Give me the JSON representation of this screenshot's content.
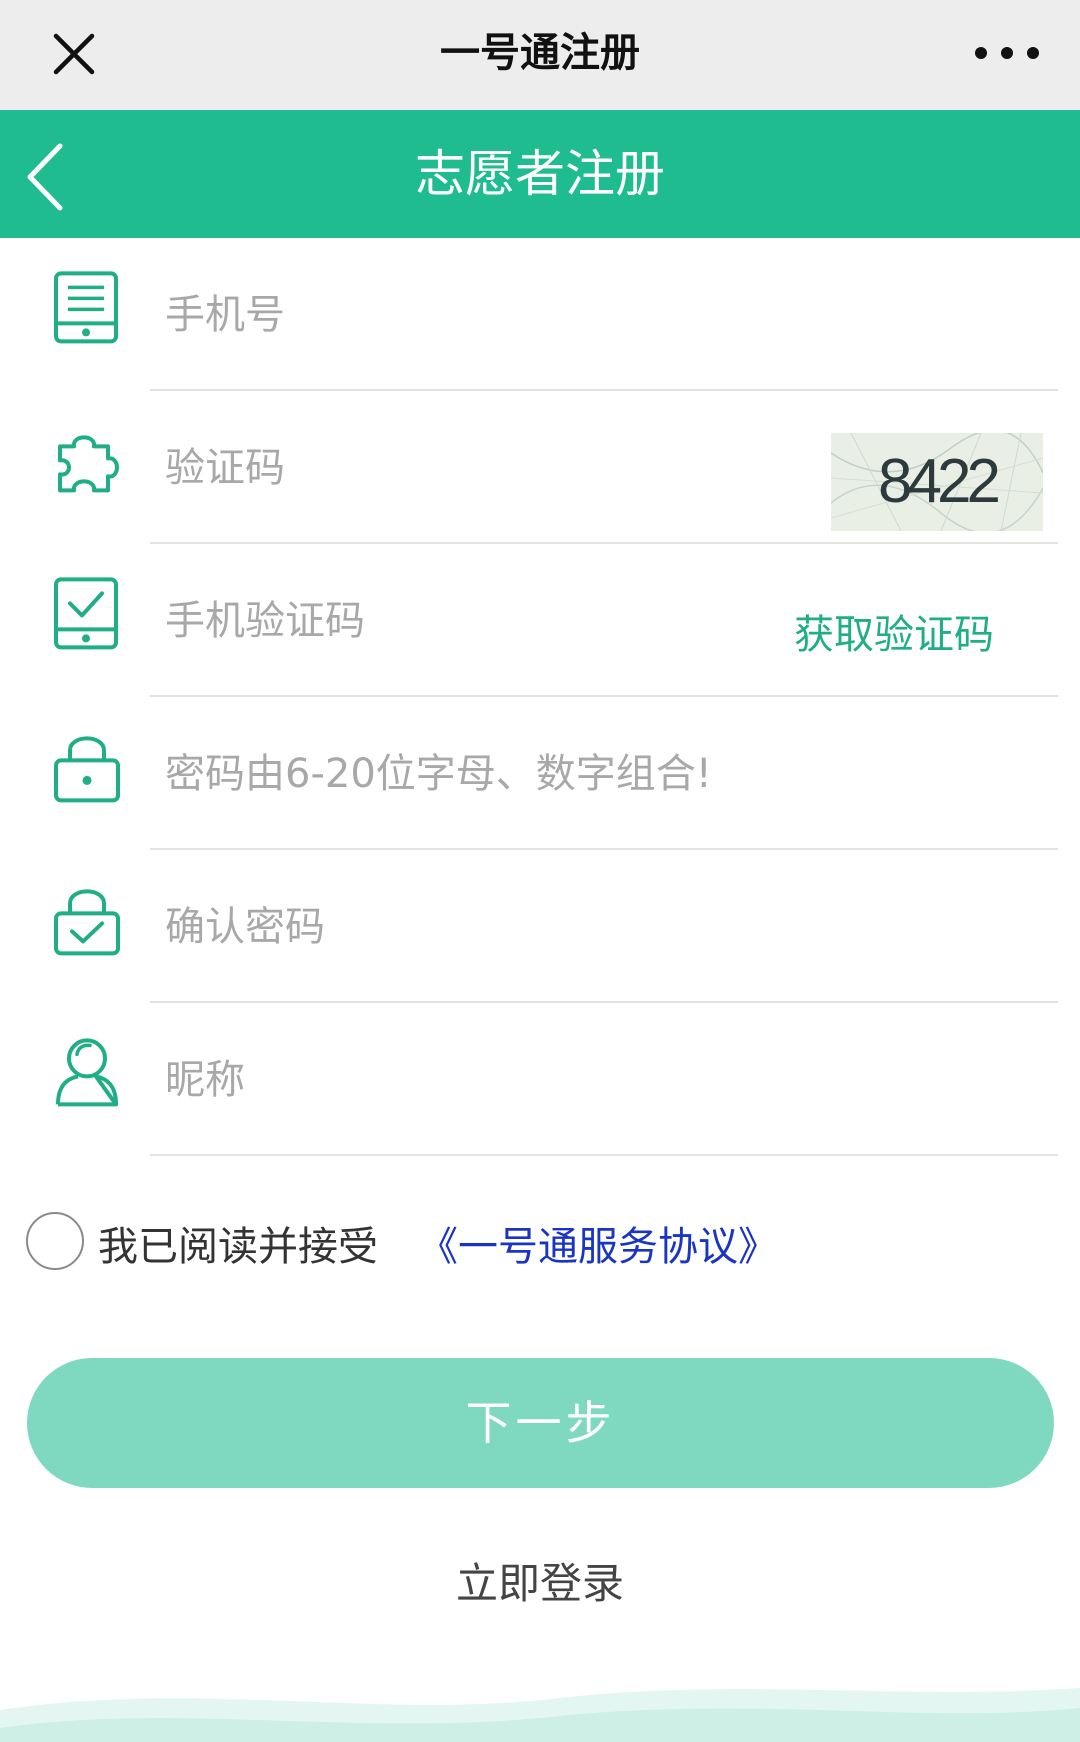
{
  "topbar": {
    "title": "一号通注册",
    "close_icon": "close-icon",
    "more_icon": "more-dots-icon"
  },
  "header": {
    "title": "志愿者注册",
    "back_icon": "chevron-left-icon"
  },
  "form": {
    "phone": {
      "placeholder": "手机号",
      "icon": "phone-icon"
    },
    "captcha": {
      "placeholder": "验证码",
      "icon": "puzzle-icon",
      "image_code": "8422"
    },
    "sms": {
      "placeholder": "手机验证码",
      "icon": "phone-check-icon",
      "get_code_label": "获取验证码"
    },
    "password": {
      "placeholder": "密码由6-20位字母、数字组合!",
      "icon": "lock-icon"
    },
    "confirm": {
      "placeholder": "确认密码",
      "icon": "lock-check-icon"
    },
    "nickname": {
      "placeholder": "昵称",
      "icon": "user-icon"
    }
  },
  "agreement": {
    "text": "我已阅读并接受",
    "link": "《一号通服务协议》"
  },
  "buttons": {
    "next": "下一步",
    "login": "立即登录"
  },
  "colors": {
    "brand": "#1fbc8f",
    "button": "#7fd9c0",
    "link": "#1a34c4",
    "icon": "#1fae86"
  }
}
